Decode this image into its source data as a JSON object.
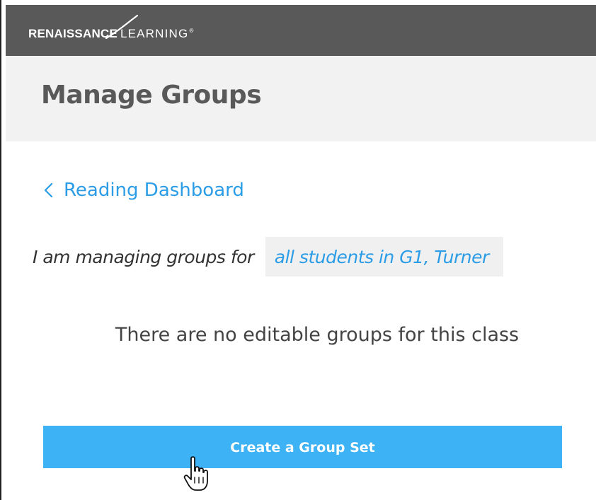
{
  "header": {
    "logo_bold": "RENAISSANCE",
    "logo_light": "LEARNING",
    "logo_mark": "®"
  },
  "page": {
    "title": "Manage Groups"
  },
  "nav": {
    "back_label": "Reading Dashboard",
    "back_icon": "chevron-left-icon"
  },
  "selector": {
    "prefix": "I am managing groups for",
    "selected_value": "all students in G1, Turner"
  },
  "empty_state": {
    "message": "There are no editable groups for this class"
  },
  "actions": {
    "create_label": "Create a Group Set"
  },
  "colors": {
    "header_bg": "#595959",
    "title_band_bg": "#f2f2f2",
    "link": "#2b9ce6",
    "primary_button": "#3db2f4"
  },
  "cursor": {
    "icon": "hand-pointer-icon"
  }
}
